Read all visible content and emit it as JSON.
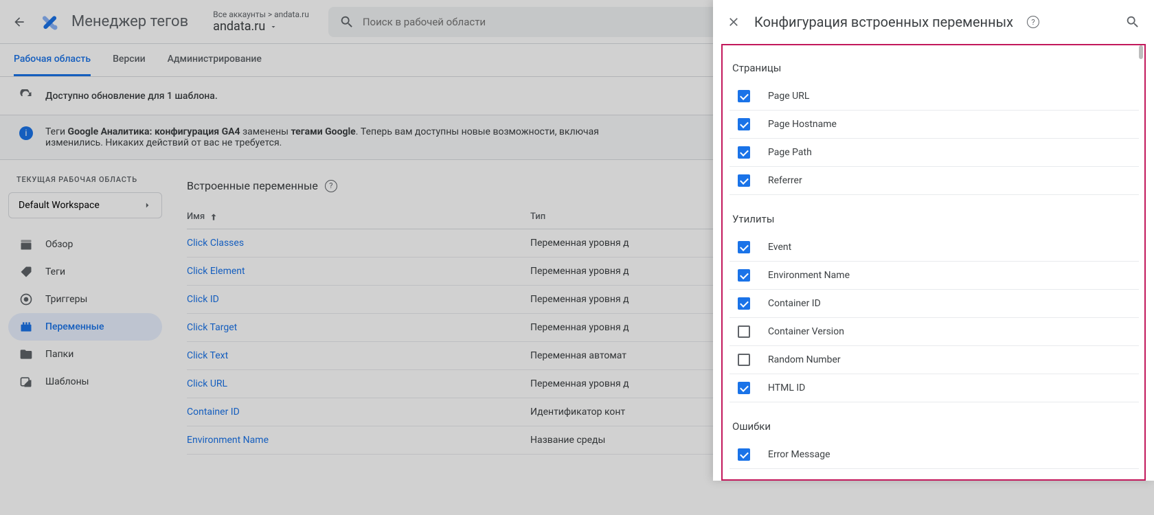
{
  "header": {
    "app_title": "Менеджер тегов",
    "breadcrumb": "Все аккаунты > andata.ru",
    "account": "andata.ru",
    "search_placeholder": "Поиск в рабочей области"
  },
  "tabs": [
    {
      "label": "Рабочая область",
      "active": true
    },
    {
      "label": "Версии",
      "active": false
    },
    {
      "label": "Администрирование",
      "active": false
    }
  ],
  "notice": "Доступно обновление для 1 шаблона.",
  "banner": {
    "prefix": "Теги ",
    "bold1": "Google Аналитика: конфигурация GA4",
    "mid": " заменены ",
    "bold2": "тегами Google",
    "suffix": ". Теперь вам доступны новые возможности, включая",
    "line2": "изменились. Никаких действий от вас не требуется."
  },
  "sidebar": {
    "ws_label": "ТЕКУЩАЯ РАБОЧАЯ ОБЛАСТЬ",
    "ws_name": "Default Workspace",
    "items": [
      {
        "label": "Обзор",
        "icon": "dashboard"
      },
      {
        "label": "Теги",
        "icon": "tag"
      },
      {
        "label": "Триггеры",
        "icon": "target"
      },
      {
        "label": "Переменные",
        "icon": "variable",
        "active": true
      },
      {
        "label": "Папки",
        "icon": "folder"
      },
      {
        "label": "Шаблоны",
        "icon": "template"
      }
    ]
  },
  "content": {
    "title": "Встроенные переменные",
    "col_name": "Имя",
    "col_type": "Тип",
    "rows": [
      {
        "name": "Click Classes",
        "type": "Переменная уровня д"
      },
      {
        "name": "Click Element",
        "type": "Переменная уровня д"
      },
      {
        "name": "Click ID",
        "type": "Переменная уровня д"
      },
      {
        "name": "Click Target",
        "type": "Переменная уровня д"
      },
      {
        "name": "Click Text",
        "type": "Переменная автомат"
      },
      {
        "name": "Click URL",
        "type": "Переменная уровня д"
      },
      {
        "name": "Container ID",
        "type": "Идентификатор конт"
      },
      {
        "name": "Environment Name",
        "type": "Название среды"
      }
    ]
  },
  "panel": {
    "title": "Конфигурация встроенных переменных",
    "sections": [
      {
        "title": "Страницы",
        "items": [
          {
            "label": "Page URL",
            "checked": true
          },
          {
            "label": "Page Hostname",
            "checked": true
          },
          {
            "label": "Page Path",
            "checked": true
          },
          {
            "label": "Referrer",
            "checked": true
          }
        ]
      },
      {
        "title": "Утилиты",
        "items": [
          {
            "label": "Event",
            "checked": true
          },
          {
            "label": "Environment Name",
            "checked": true
          },
          {
            "label": "Container ID",
            "checked": true
          },
          {
            "label": "Container Version",
            "checked": false
          },
          {
            "label": "Random Number",
            "checked": false
          },
          {
            "label": "HTML ID",
            "checked": true
          }
        ]
      },
      {
        "title": "Ошибки",
        "items": [
          {
            "label": "Error Message",
            "checked": true
          }
        ]
      }
    ]
  }
}
